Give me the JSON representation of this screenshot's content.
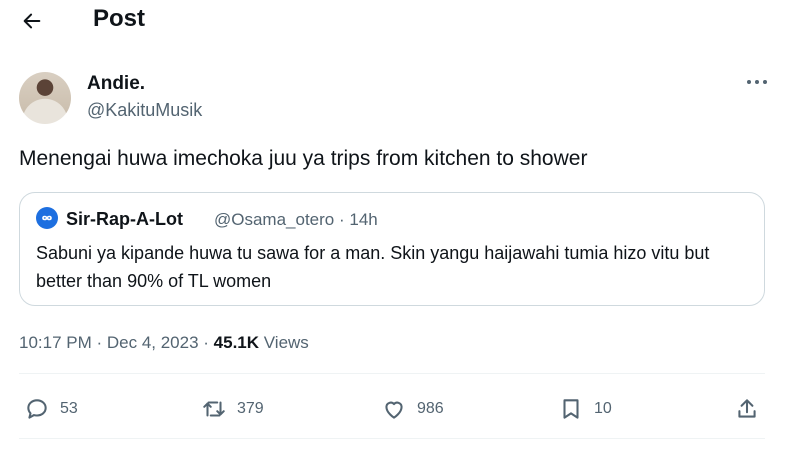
{
  "header": {
    "title": "Post"
  },
  "author": {
    "name": "Andie.",
    "handle": "@KakituMusik"
  },
  "post": {
    "text": "Menengai huwa imechoka juu ya trips from kitchen to shower"
  },
  "quote": {
    "name": "Sir-Rap-A-Lot",
    "meta": "@Osama_otero · 14h",
    "text": "Sabuni ya kipande huwa tu sawa for a man. Skin yangu haijawahi tumia hizo vitu but better than 90% of TL women"
  },
  "timestamp": {
    "time_date": "10:17 PM · Dec 4, 2023 · ",
    "views_count": "45.1K",
    "views_label": " Views"
  },
  "actions": {
    "replies": "53",
    "reposts": "379",
    "likes": "986",
    "bookmarks": "10"
  },
  "icons": [
    "back-arrow-icon",
    "more-icon",
    "reply-icon",
    "repost-icon",
    "like-icon",
    "bookmark-icon",
    "share-icon"
  ]
}
